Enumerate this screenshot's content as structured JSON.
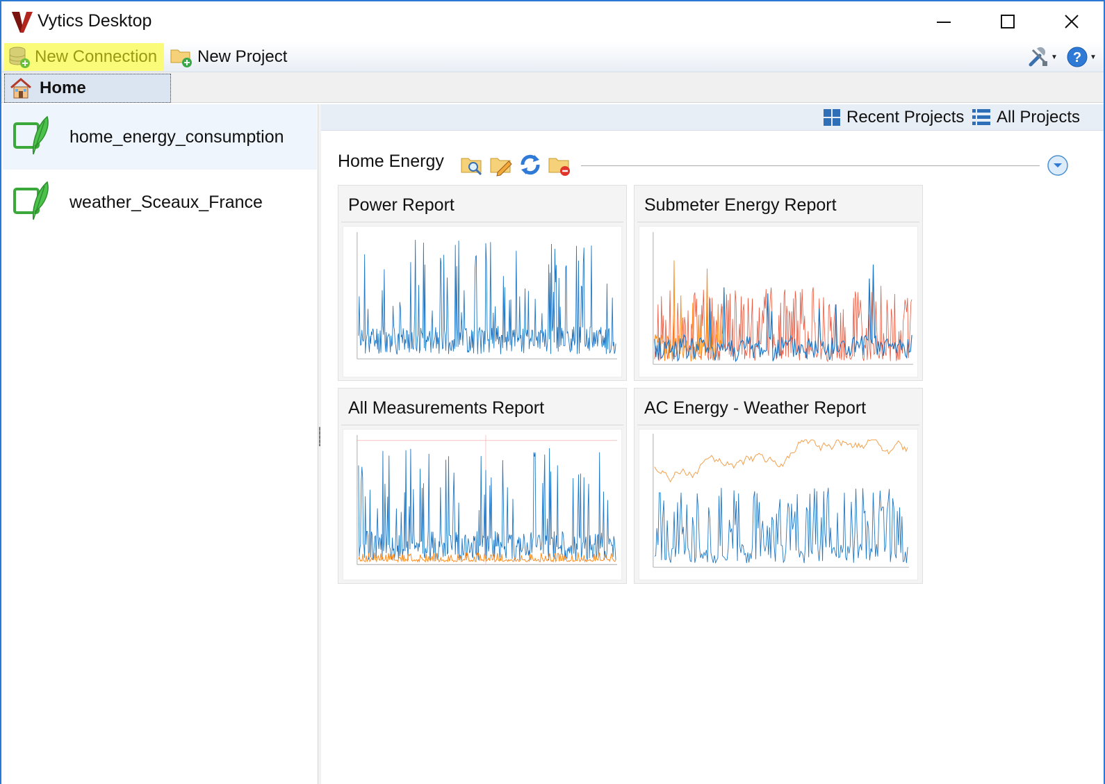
{
  "window": {
    "title": "Vytics Desktop"
  },
  "toolbar": {
    "new_connection": "New Connection",
    "new_project": "New Project"
  },
  "tabs": [
    {
      "label": "Home"
    }
  ],
  "sidebar": {
    "items": [
      {
        "label": "home_energy_consumption",
        "selected": true
      },
      {
        "label": "weather_Sceaux_France",
        "selected": false
      }
    ]
  },
  "views": {
    "recent": "Recent Projects",
    "all": "All Projects"
  },
  "project_group": {
    "title": "Home Energy",
    "reports": [
      {
        "title": "Power Report"
      },
      {
        "title": "Submeter Energy Report"
      },
      {
        "title": "All Measurements Report"
      },
      {
        "title": "AC Energy - Weather Report"
      }
    ]
  },
  "colors": {
    "highlight": "#fbfb7a",
    "accent": "#2b78d4",
    "series_blue": "#1f77c4",
    "series_orange": "#ff8c1a",
    "series_red": "#e8553a"
  }
}
